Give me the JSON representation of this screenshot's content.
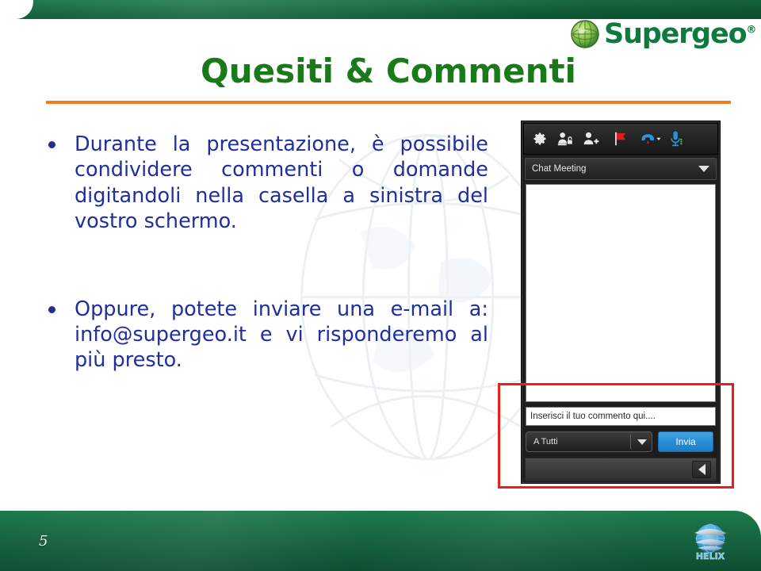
{
  "slide": {
    "title": "Quesiti & Commenti",
    "page_number": "5",
    "title_color": "#1a7a1a",
    "rule_color": "#ef7d22",
    "body_text_color": "#1f2f9e",
    "header_green": "#13693f",
    "footer_green": "#176441"
  },
  "brand": {
    "name": "Supergeo",
    "registered_mark": "®",
    "footer_logo_text": "HELIX"
  },
  "bullets": [
    {
      "text": "Durante la presentazione, è possibile condividere commenti o domande digitandoli nella casella a sinistra del vostro schermo."
    },
    {
      "text": "Oppure, potete inviare una e-mail a: info@supergeo.it e vi risponderemo al più presto."
    }
  ],
  "contact_email": "info@supergeo.it",
  "chat_panel": {
    "toolbar_icons": [
      "gear-icon",
      "share-control-icon",
      "add-person-icon",
      "red-flag-icon",
      "phone-dropdown-icon",
      "microphone-icon"
    ],
    "mode_select": {
      "value": "Chat Meeting"
    },
    "message_input": {
      "placeholder": "Inserisci il tuo commento qui....",
      "value": "Inserisci il tuo commento qui...."
    },
    "recipient_select": {
      "value": "A Tutti"
    },
    "send_button": {
      "label": "Invia",
      "color": "#2a8ed6"
    },
    "collapse_button": "collapse-left-arrow-icon"
  },
  "annotation": {
    "highlight_box_color": "#ee1c1c"
  }
}
